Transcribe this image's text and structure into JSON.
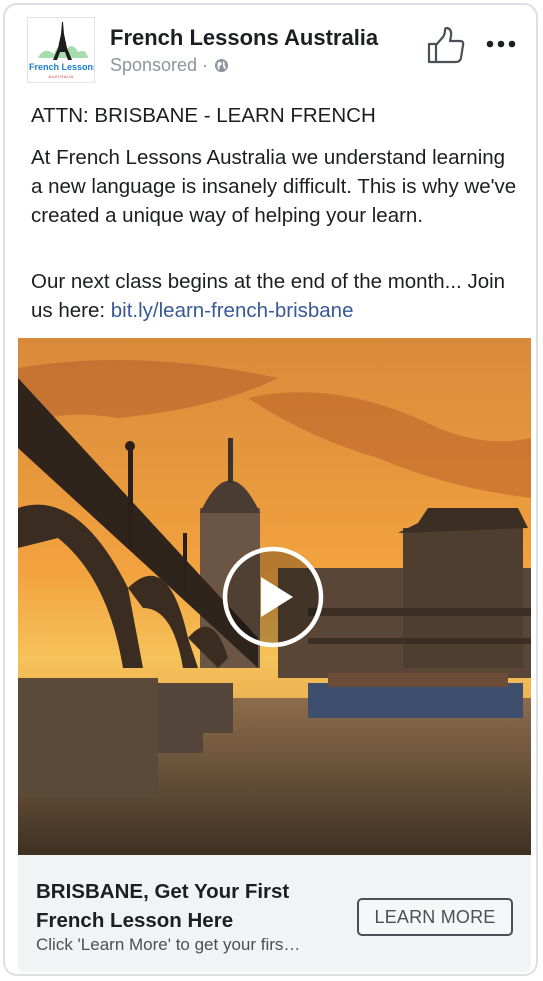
{
  "post": {
    "page_name": "French Lessons Australia",
    "sponsored_label": "Sponsored ·",
    "logo": {
      "text": "French Lessons",
      "subtext": "AUSTRALIA"
    },
    "headline": "ATTN: BRISBANE - LEARN FRENCH",
    "paragraph1": "At French Lessons Australia we understand learning a new language is insanely difficult. This is why we've created a unique way of helping your learn.",
    "paragraph2_prefix": "Our next class begins at the end of the month... Join us here: ",
    "paragraph2_link": "bit.ly/learn-french-brisbane"
  },
  "icons": {
    "like": "thumbs-up-icon",
    "more": "more-options-icon",
    "globe": "globe-icon",
    "play": "play-icon"
  },
  "cta": {
    "title": "BRISBANE, Get Your First French Lesson Here",
    "description": "Click 'Learn More' to get your firs…",
    "button_label": "LEARN MORE"
  },
  "colors": {
    "link": "#385898",
    "page_name": "#1c1e21",
    "meta": "#90949c",
    "cta_background": "#f2f3f5"
  }
}
